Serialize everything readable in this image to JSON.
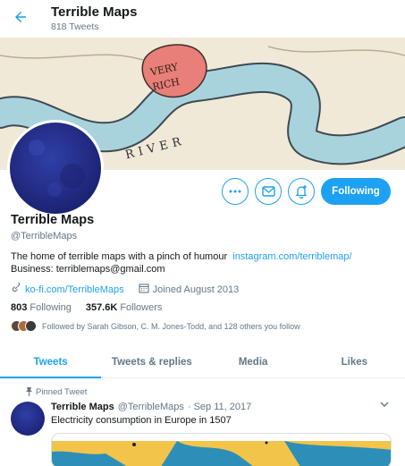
{
  "header": {
    "name": "Terrible Maps",
    "tweet_count": "818 Tweets"
  },
  "banner": {
    "label_rich_1": "VERY",
    "label_rich_2": "RICH",
    "label_river": "RIVER"
  },
  "profile": {
    "name": "Terrible Maps",
    "handle": "@TerribleMaps",
    "bio_text": "The home of terrible maps with a pinch of humour",
    "bio_link": "instagram.com/terriblemap/",
    "bio_business": "Business: terriblemaps@gmail.com",
    "website": "ko-fi.com/TerribleMaps",
    "joined": "Joined August 2013",
    "following_count": "803",
    "following_label": "Following",
    "followers_count": "357.6K",
    "followers_label": "Followers",
    "followed_by": "Followed by Sarah Gibson, C. M. Jones-Todd, and 128 others you follow"
  },
  "actions": {
    "follow_label": "Following"
  },
  "tabs": [
    {
      "label": "Tweets"
    },
    {
      "label": "Tweets & replies"
    },
    {
      "label": "Media"
    },
    {
      "label": "Likes"
    }
  ],
  "tweet": {
    "pinned_label": "Pinned Tweet",
    "name": "Terrible Maps",
    "handle": "@TerribleMaps",
    "date": "· Sep 11, 2017",
    "text": "Electricity consumption in Europe in 1507"
  },
  "colors": {
    "accent": "#1da1f2",
    "secondary_text": "#657786"
  }
}
